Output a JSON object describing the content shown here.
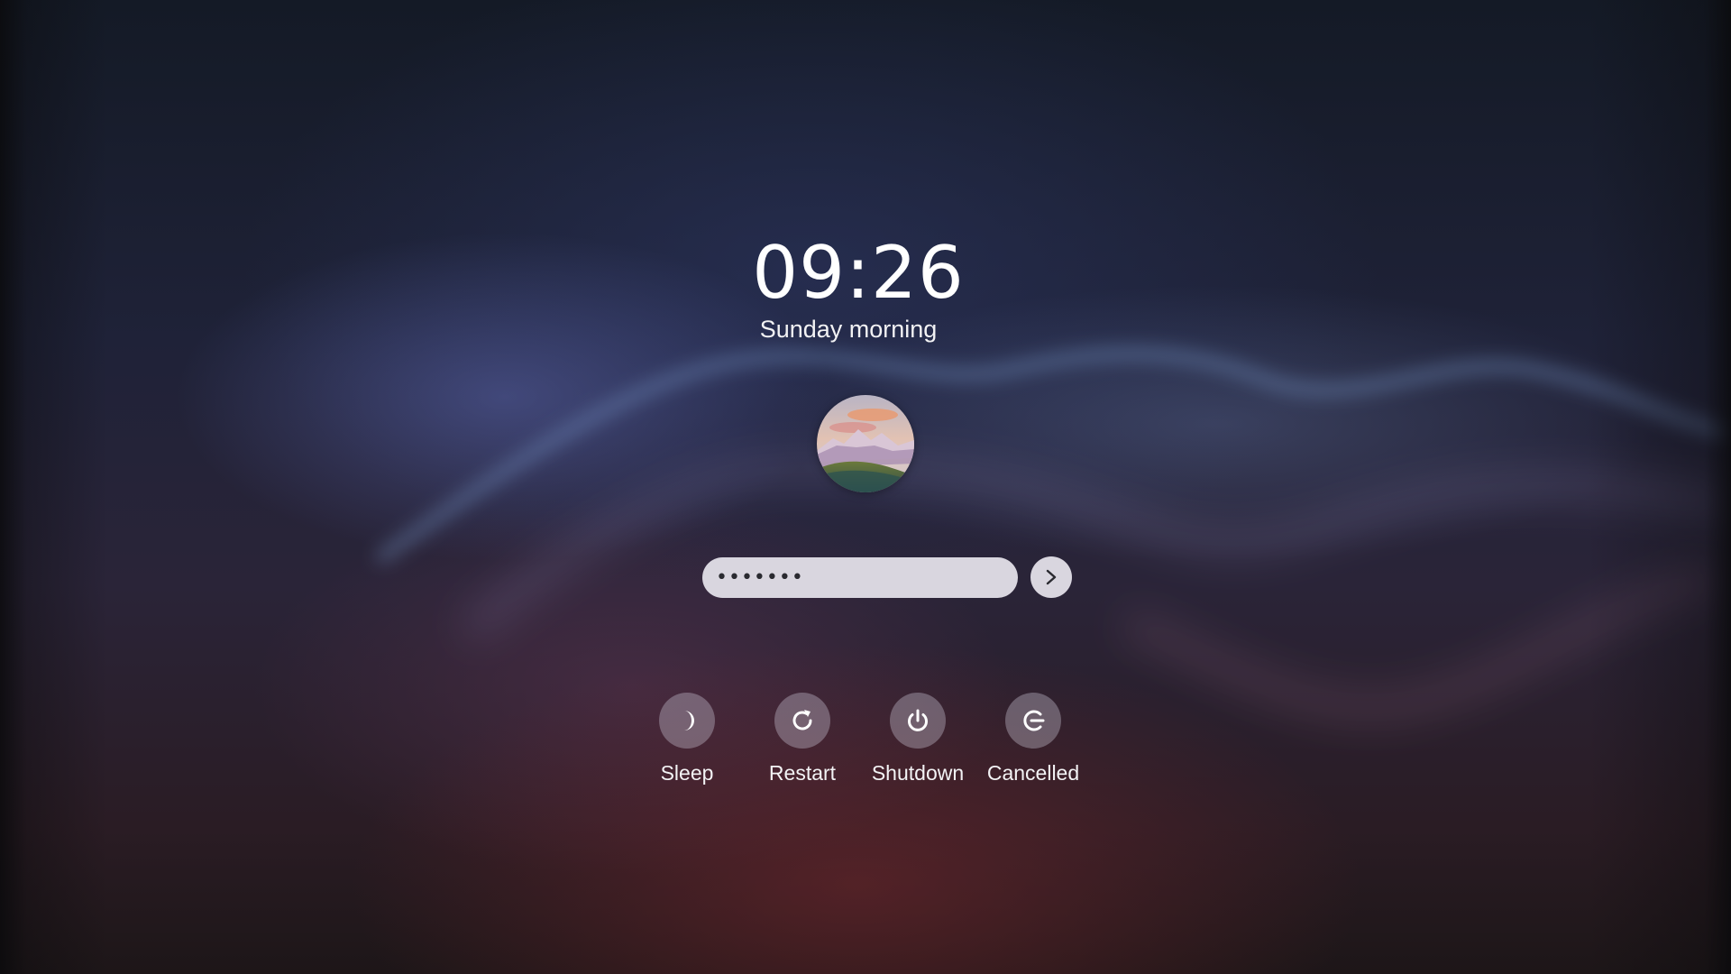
{
  "lock_screen": {
    "time": "09:26",
    "greeting": "Sunday morning",
    "password": {
      "masked_value": "●●●●●●●",
      "length": 7
    },
    "avatar": {
      "icon": "mountain-landscape-avatar"
    },
    "submit": {
      "icon": "chevron-right-icon"
    }
  },
  "power_actions": [
    {
      "label": "Sleep",
      "icon": "moon-icon"
    },
    {
      "label": "Restart",
      "icon": "restart-icon"
    },
    {
      "label": "Shutdown",
      "icon": "power-icon"
    },
    {
      "label": "Cancelled",
      "icon": "logout-icon"
    }
  ],
  "colors": {
    "input_background": "#d9d6df",
    "action_circle": "#8d8898",
    "text": "#ffffff"
  }
}
